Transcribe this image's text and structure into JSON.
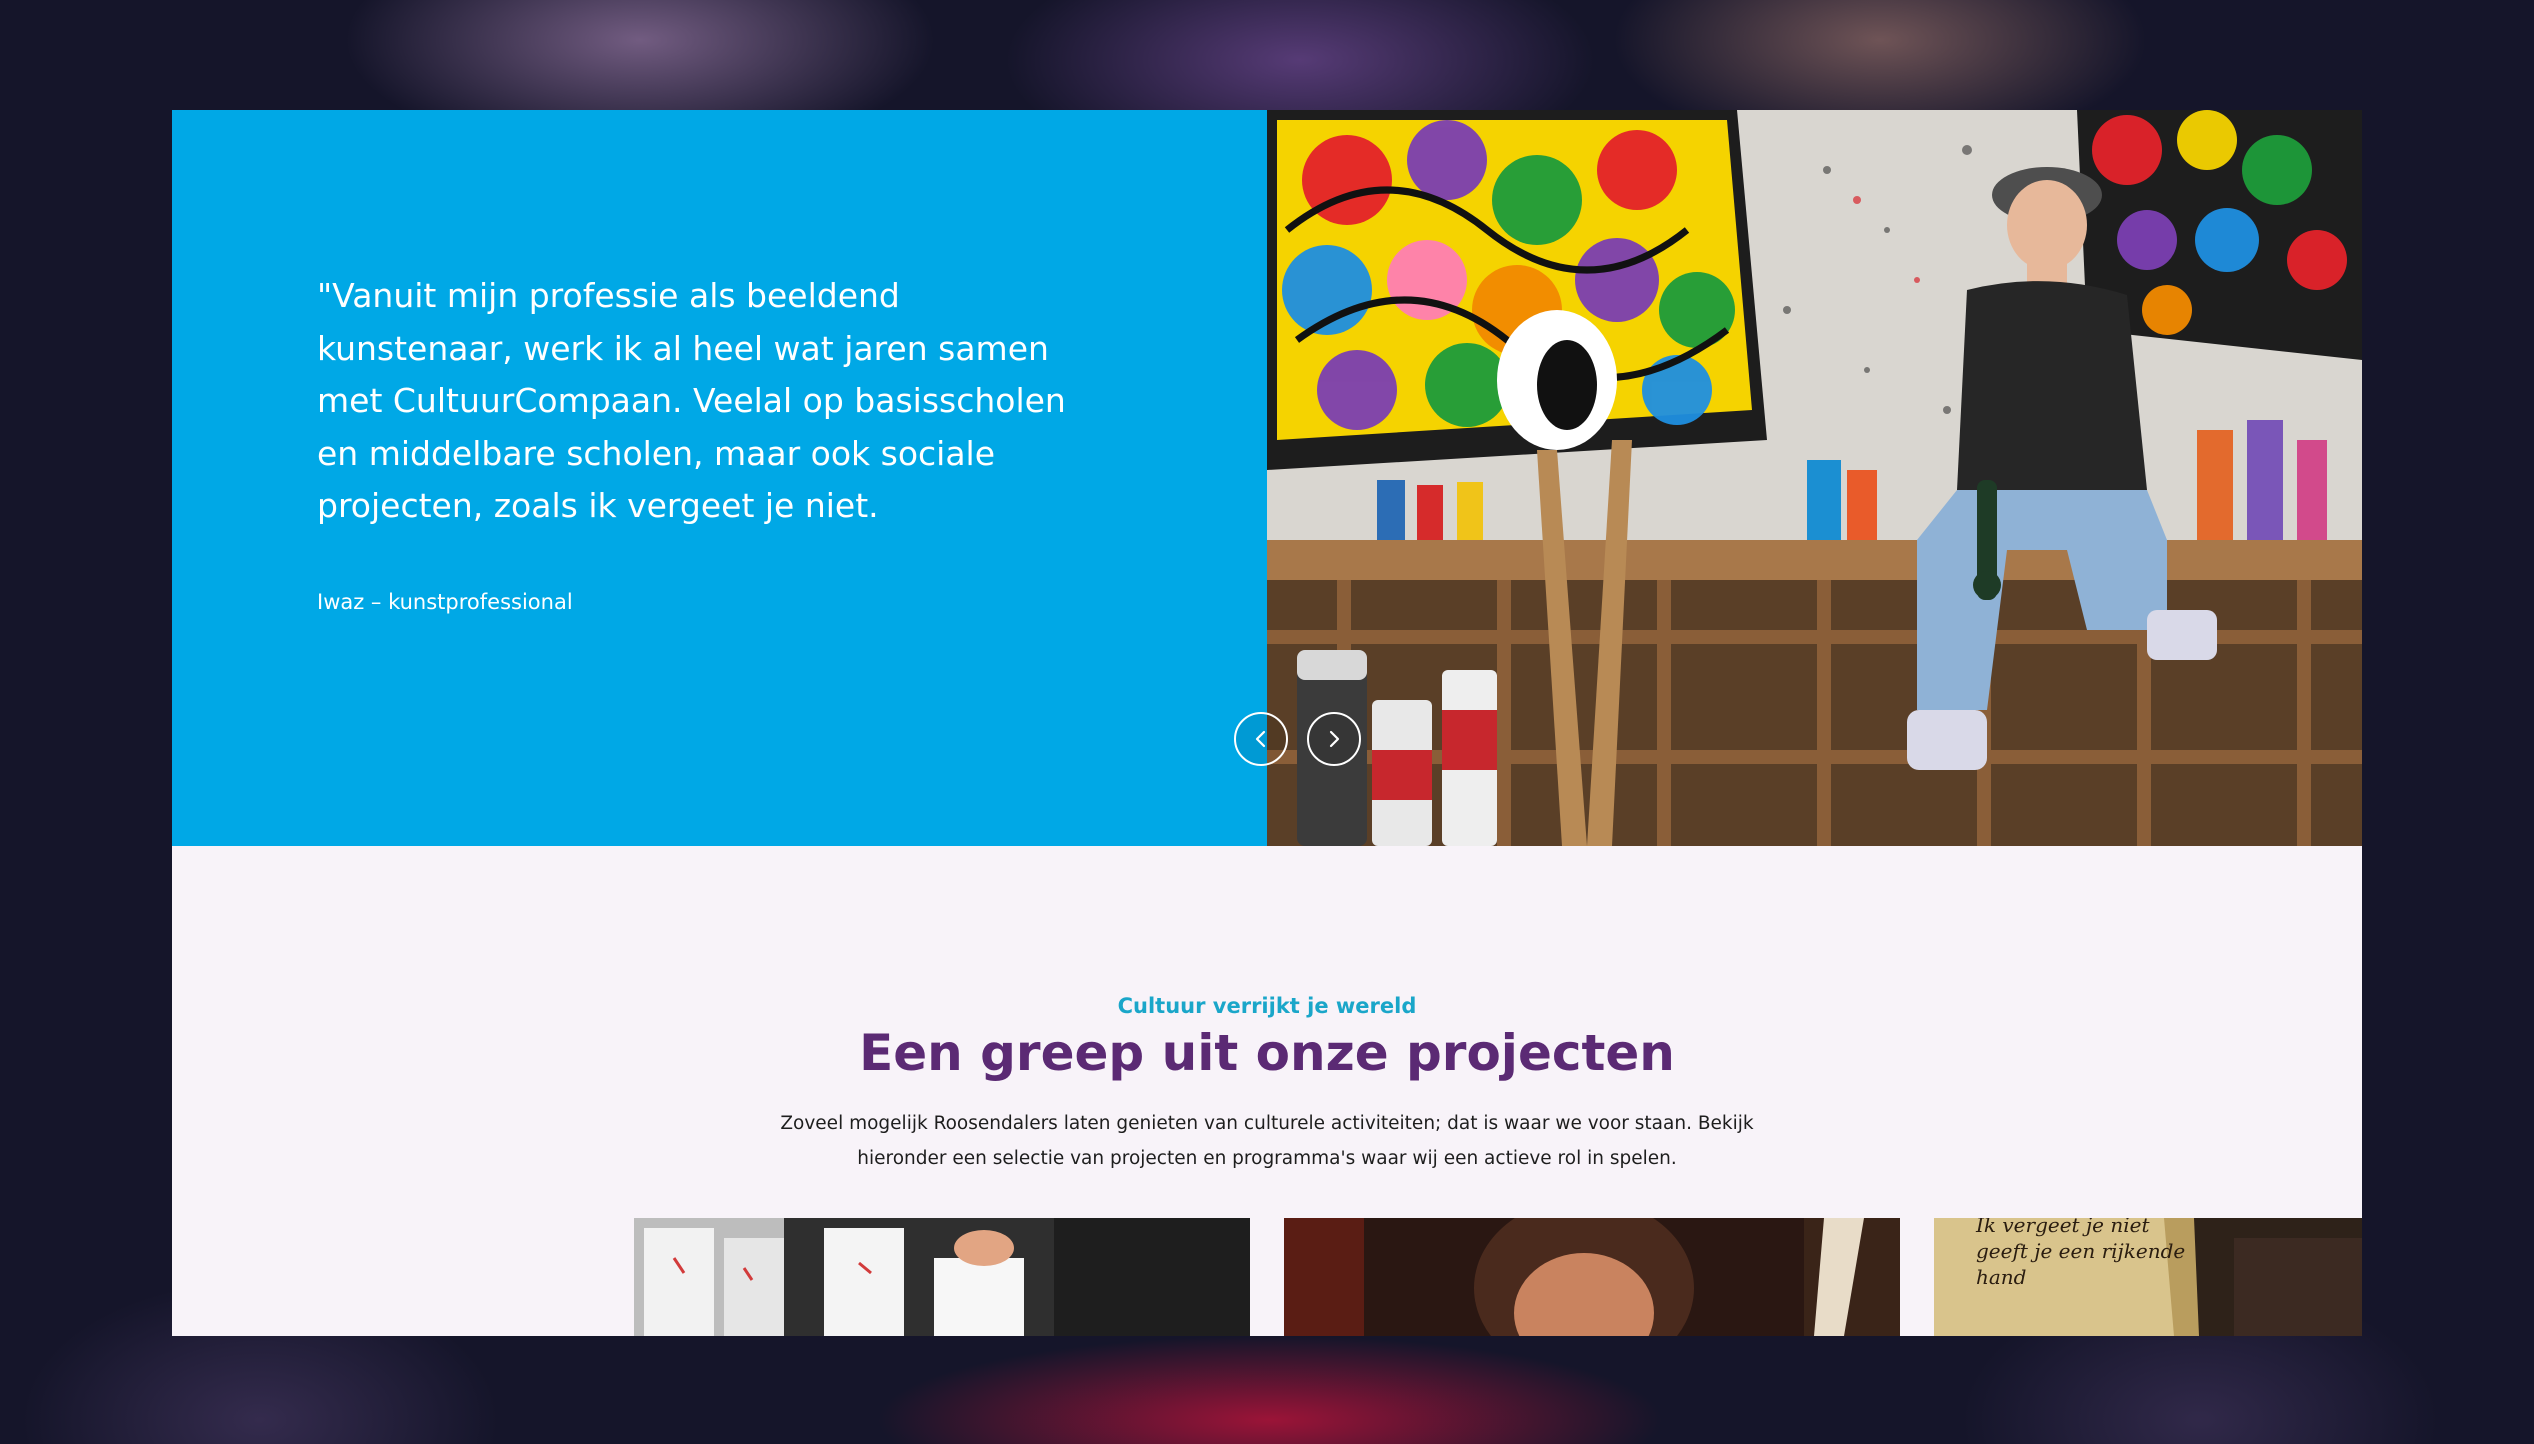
{
  "testimonial": {
    "quote": "\"Vanuit mijn professie als beeldend kunstenaar, werk ik al heel wat jaren samen met CultuurCompaan. Veelal op basisscholen en middelbare scholen, maar ook sociale projecten, zoals ik vergeet je niet.",
    "author": "Iwaz – kunstprofessional",
    "background_color": "#00a8e6"
  },
  "slider": {
    "prev_icon": "chevron-left-icon",
    "next_icon": "chevron-right-icon"
  },
  "projects": {
    "eyebrow": "Cultuur verrijkt je wereld",
    "title": "Een greep uit onze projecten",
    "intro": "Zoveel mogelijk Roosendalers laten genieten van culturele activiteiten; dat is waar we voor staan. Bekijk hieronder een selectie van projecten en programma's waar wij een actieve rol in spelen.",
    "cards": [
      {
        "image": "paper-bags-photo"
      },
      {
        "image": "portrait-photo"
      },
      {
        "image": "parchment-photo",
        "visible_text": "Ik vergeet je niet\ngeeft je een rijkende\nhand"
      }
    ]
  },
  "colors": {
    "accent_blue": "#00a8e6",
    "heading_purple": "#5b2a74",
    "eyebrow_teal": "#1aa6c9",
    "section_bg": "#f8f3f9"
  }
}
